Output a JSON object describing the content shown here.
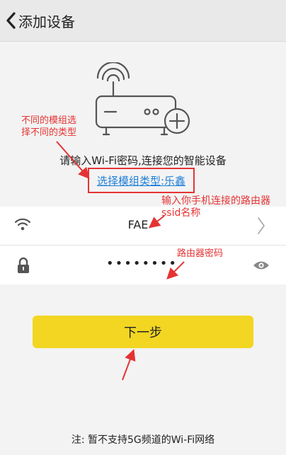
{
  "header": {
    "title": "添加设备",
    "back_icon": "chevron-left-icon"
  },
  "illustration": {
    "icon": "wifi-router-add-icon"
  },
  "prompt": {
    "text": "请输入Wi-Fi密码,连接您的智能设备"
  },
  "module": {
    "link_text": "选择模组类型:乐鑫"
  },
  "wifi": {
    "ssid_value": "FAE",
    "password_value": "••••••••",
    "wifi_icon": "wifi-icon",
    "lock_icon": "lock-icon",
    "chevron_icon": "chevron-right-icon",
    "eye_icon": "eye-icon"
  },
  "actions": {
    "next_label": "下一步"
  },
  "footer": {
    "note": "注: 暂不支持5G频道的Wi-Fi网络"
  },
  "annotations": {
    "module_note_line1": "不同的模组选",
    "module_note_line2": "择不同的类型",
    "ssid_note_line1": "输入你手机连接的路由器",
    "ssid_note_line2": "ssid名称",
    "password_note": "路由器密码"
  },
  "colors": {
    "accent_yellow": "#f2d622",
    "annotation_red": "#e53333",
    "link_blue": "#1e7fd8"
  }
}
